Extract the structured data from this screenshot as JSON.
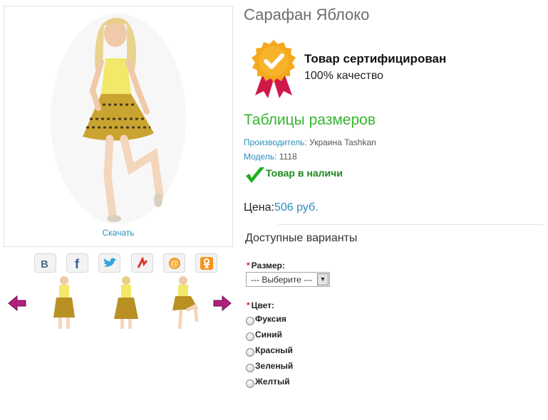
{
  "product": {
    "title": "Сарафан Яблоко",
    "download_label": "Скачать"
  },
  "social": [
    "vk-icon",
    "facebook-icon",
    "twitter-icon",
    "yandex-icon",
    "mail-ru-icon",
    "odnoklassniki-icon"
  ],
  "certificate": {
    "title": "Товар сертифицирован",
    "subtitle": "100% качество"
  },
  "size_table_link": "Таблицы размеров",
  "meta": {
    "manufacturer_label": "Производитель:",
    "manufacturer_value": "Украина Tashkan",
    "model_label": "Модель:",
    "model_value": "1118"
  },
  "stock_status": "Товар в наличи",
  "price": {
    "label": "Цена:",
    "value": "506 руб."
  },
  "variants": {
    "title": "Доступные варианты",
    "size_label": "Размер:",
    "size_selected": "--- Выберите ---",
    "color_label": "Цвет:",
    "colors": [
      "Фуксия",
      "Синий",
      "Красный",
      "Зеленый",
      "Желтый"
    ]
  },
  "colors": {
    "accent_blue": "#2a8fc0",
    "accent_green": "#38b52f",
    "stock_green": "#1b8a1b",
    "required_red": "#e02020"
  }
}
